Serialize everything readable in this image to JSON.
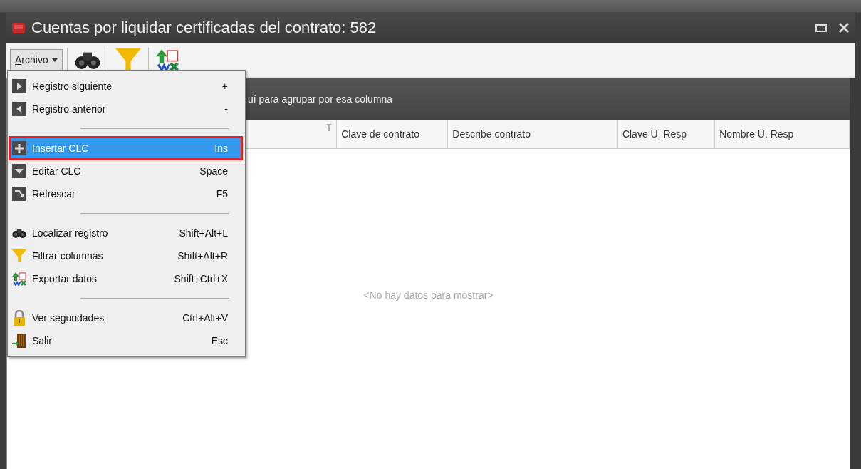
{
  "window": {
    "title": "Cuentas por liquidar certificadas del contrato: 582"
  },
  "toolbar": {
    "menu_button": {
      "label": "Archivo",
      "expanded": true
    }
  },
  "group_panel": {
    "hint": "uí para agrupar por esa columna"
  },
  "table": {
    "columns": [
      {
        "filter": true
      },
      {
        "label": "Clave de contrato",
        "filter": false
      },
      {
        "label": "Describe contrato",
        "filter": false
      },
      {
        "label": "Clave U. Resp",
        "filter": false
      },
      {
        "label": "Nombre U. Resp",
        "filter": false
      }
    ],
    "empty_text": "<No hay datos para mostrar>"
  },
  "menu": {
    "items": [
      {
        "kind": "item",
        "label": "Registro siguiente",
        "shortcut": "+",
        "selected": false
      },
      {
        "kind": "item",
        "label": "Registro anterior",
        "shortcut": "-",
        "selected": false
      },
      {
        "kind": "separator"
      },
      {
        "kind": "item",
        "label": "Insertar CLC",
        "shortcut": "Ins",
        "selected": true
      },
      {
        "kind": "item",
        "label": "Editar CLC",
        "shortcut": "Space",
        "selected": false
      },
      {
        "kind": "item",
        "label": "Refrescar",
        "shortcut": "F5",
        "selected": false
      },
      {
        "kind": "separator"
      },
      {
        "kind": "item",
        "label": "Localizar registro",
        "shortcut": "Shift+Alt+L",
        "selected": false
      },
      {
        "kind": "item",
        "label": "Filtrar columnas",
        "shortcut": "Shift+Alt+R",
        "selected": false
      },
      {
        "kind": "item",
        "label": "Exportar datos",
        "shortcut": "Shift+Ctrl+X",
        "selected": false
      },
      {
        "kind": "separator"
      },
      {
        "kind": "item",
        "label": "Ver seguridades",
        "shortcut": "Ctrl+Alt+V",
        "selected": false
      },
      {
        "kind": "item",
        "label": "Salir",
        "shortcut": "Esc",
        "selected": false
      }
    ]
  }
}
